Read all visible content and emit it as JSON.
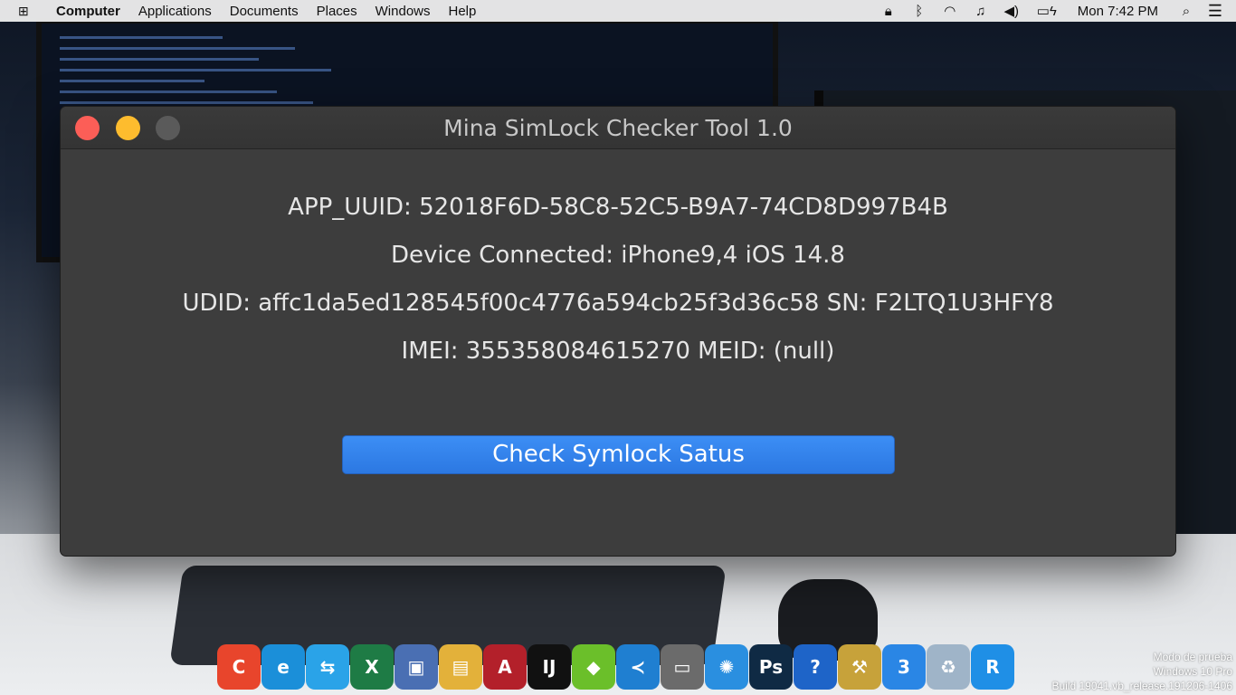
{
  "menubar": {
    "logo_icon": "windows-logo-icon",
    "items": [
      "Computer",
      "Applications",
      "Documents",
      "Places",
      "Windows",
      "Help"
    ],
    "tray_icons": [
      "lock-icon",
      "bluetooth-icon",
      "wifi-icon",
      "music-icon",
      "volume-icon",
      "battery-charging-icon"
    ],
    "clock": "Mon 7:42 PM",
    "search_icon": "search-icon",
    "menu_icon": "list-menu-icon"
  },
  "window": {
    "title": "Mina SimLock Checker Tool 1.0",
    "controls": [
      "close",
      "minimize",
      "maximize"
    ],
    "app_uuid": "APP_UUID: 52018F6D-58C8-52C5-B9A7-74CD8D997B4B",
    "device": "Device Connected: iPhone9,4 iOS 14.8",
    "udid_sn": "UDID: affc1da5ed128545f00c4776a594cb25f3d36c58 SN: F2LTQ1U3HFY8",
    "imei_meid": "IMEI: 355358084615270 MEID: (null)",
    "check_button": "Check Symlock Satus"
  },
  "dock": {
    "apps": [
      {
        "icon": "ccleaner-icon",
        "glyph": "C",
        "color": "#e8452c"
      },
      {
        "icon": "edge-browser-icon",
        "glyph": "e",
        "color": "#1b8fd9"
      },
      {
        "icon": "transfer-arrows-icon",
        "glyph": "⇆",
        "color": "#2aa3e8"
      },
      {
        "icon": "excel-icon",
        "glyph": "X",
        "color": "#1e7b45"
      },
      {
        "icon": "virtualbox-icon",
        "glyph": "▣",
        "color": "#4a6fb3"
      },
      {
        "icon": "files-folder-icon",
        "glyph": "▤",
        "color": "#e3b13a"
      },
      {
        "icon": "arduino-style-icon",
        "glyph": "A",
        "color": "#b3202a"
      },
      {
        "icon": "intellij-icon",
        "glyph": "IJ",
        "color": "#111111"
      },
      {
        "icon": "green-cube-icon",
        "glyph": "◆",
        "color": "#6bbf2a"
      },
      {
        "icon": "vscode-icon",
        "glyph": "≺",
        "color": "#1f7fd1"
      },
      {
        "icon": "usb-drive-icon",
        "glyph": "▭",
        "color": "#6b6b6b"
      },
      {
        "icon": "network-hub-icon",
        "glyph": "✺",
        "color": "#2a8fe0"
      },
      {
        "icon": "photoshop-icon",
        "glyph": "Ps",
        "color": "#0f2a44"
      },
      {
        "icon": "help-question-icon",
        "glyph": "?",
        "color": "#1e64c8"
      },
      {
        "icon": "tools-hammer-icon",
        "glyph": "⚒",
        "color": "#c7a23a"
      },
      {
        "icon": "3utools-icon",
        "glyph": "3",
        "color": "#2a86e5"
      },
      {
        "icon": "recycle-bin-icon",
        "glyph": "♻",
        "color": "#9fb4c8"
      },
      {
        "icon": "reiboot-icon",
        "glyph": "R",
        "color": "#1f8fe6"
      }
    ]
  },
  "watermark": {
    "line1": "Modo de prueba",
    "line2": "Windows 10 Pro",
    "line3": "Build 19041.vb_release.191206-1406"
  }
}
